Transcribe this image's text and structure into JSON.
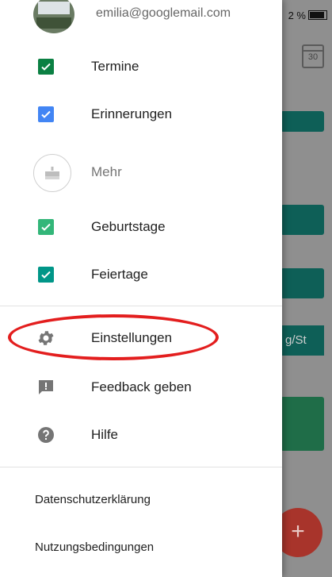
{
  "status": {
    "battery_text": "2 %"
  },
  "background": {
    "calendar_day": "30",
    "event_fragment": "g/St",
    "fab_symbol": "+"
  },
  "account": {
    "email": "emilia@googlemail.com"
  },
  "calendars": [
    {
      "label": "Termine",
      "checked": true,
      "color": "#0b8043"
    },
    {
      "label": "Erinnerungen",
      "checked": true,
      "color": "#4285f4"
    }
  ],
  "more": {
    "label": "Mehr"
  },
  "more_calendars": [
    {
      "label": "Geburtstage",
      "checked": true,
      "color": "#33b679"
    },
    {
      "label": "Feiertage",
      "checked": true,
      "color": "#009688"
    }
  ],
  "menu": {
    "settings": "Einstellungen",
    "feedback": "Feedback geben",
    "help": "Hilfe"
  },
  "footer": {
    "privacy": "Datenschutzerklärung",
    "terms": "Nutzungsbedingungen"
  },
  "colors": {
    "highlight": "#e31e1e",
    "fab": "#a8342b"
  }
}
